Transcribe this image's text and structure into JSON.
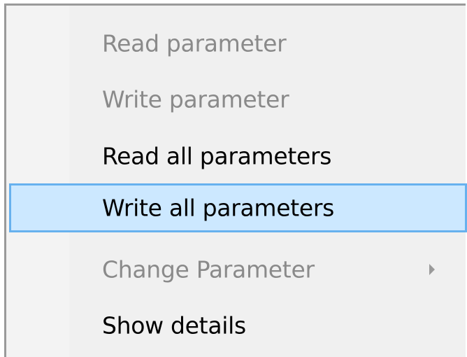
{
  "context_menu": {
    "items": [
      {
        "label": "Read parameter",
        "state": "disabled"
      },
      {
        "label": "Write parameter",
        "state": "disabled"
      },
      {
        "label": "Read all parameters",
        "state": "enabled"
      },
      {
        "label": "Write all parameters",
        "state": "highlighted"
      },
      {
        "label": "Change Parameter",
        "state": "disabled",
        "submenu": "chevron-right-icon"
      },
      {
        "label": "Show details",
        "state": "enabled"
      }
    ],
    "colors": {
      "background": "#f0f0f0",
      "disabled_text": "#8a8a8a",
      "enabled_text": "#000000",
      "highlight_fill": "#cce8ff",
      "highlight_border": "#67b1ee"
    }
  }
}
